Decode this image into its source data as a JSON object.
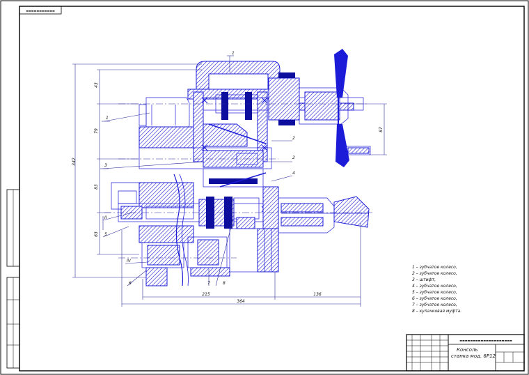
{
  "legend": [
    "1 – зубчатое колесо,",
    "2 – зубчатое колесо,",
    "3 – штифт,",
    "4 – зубчатое колесо,",
    "5 – зубчатое колесо,",
    "6 – зубчатое колесо,",
    "7 – зубчатое колесо,",
    "8 – кулачковая муфта."
  ],
  "title_block": {
    "title_line1": "Консоль",
    "title_line2": "станка мод. 6Р12"
  },
  "colors": {
    "ink": "#1c1cd8",
    "frame": "#000000"
  }
}
